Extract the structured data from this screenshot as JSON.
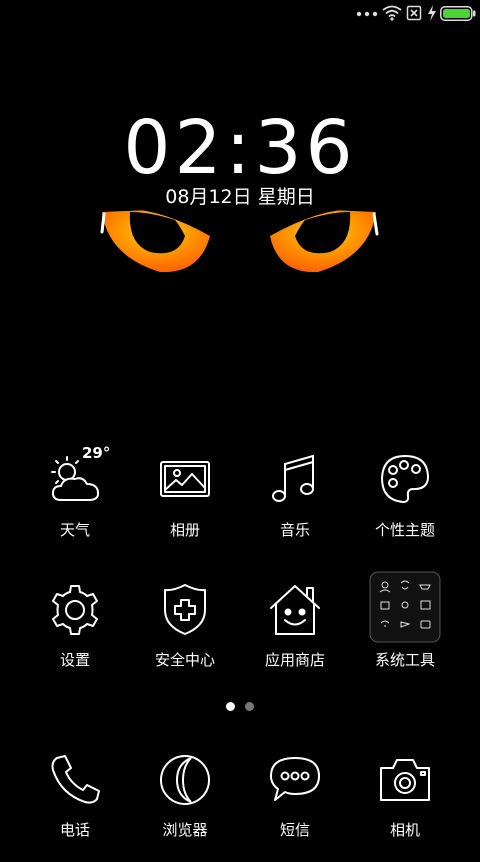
{
  "status_bar": {
    "icons": [
      "more-dots-icon",
      "wifi-icon",
      "no-sim-icon",
      "charging-bolt-icon",
      "battery-icon"
    ],
    "battery_color": "#4cd137"
  },
  "lockclock": {
    "time": "02:36",
    "date": "08月12日 星期日"
  },
  "wallpaper": {
    "eye_color": "#ff9a00"
  },
  "weather": {
    "temperature": "29°"
  },
  "apps_row1": [
    {
      "label": "天气",
      "icon": "weather-icon"
    },
    {
      "label": "相册",
      "icon": "gallery-icon"
    },
    {
      "label": "音乐",
      "icon": "music-icon"
    },
    {
      "label": "个性主题",
      "icon": "theme-palette-icon"
    }
  ],
  "apps_row2": [
    {
      "label": "设置",
      "icon": "settings-gear-icon"
    },
    {
      "label": "安全中心",
      "icon": "security-shield-icon"
    },
    {
      "label": "应用商店",
      "icon": "app-store-house-icon"
    },
    {
      "label": "系统工具",
      "icon": "system-tools-folder-icon"
    }
  ],
  "page_indicator": {
    "pages": 2,
    "current": 1
  },
  "dock": [
    {
      "label": "电话",
      "icon": "phone-icon"
    },
    {
      "label": "浏览器",
      "icon": "browser-icon"
    },
    {
      "label": "短信",
      "icon": "messages-icon"
    },
    {
      "label": "相机",
      "icon": "camera-icon"
    }
  ]
}
